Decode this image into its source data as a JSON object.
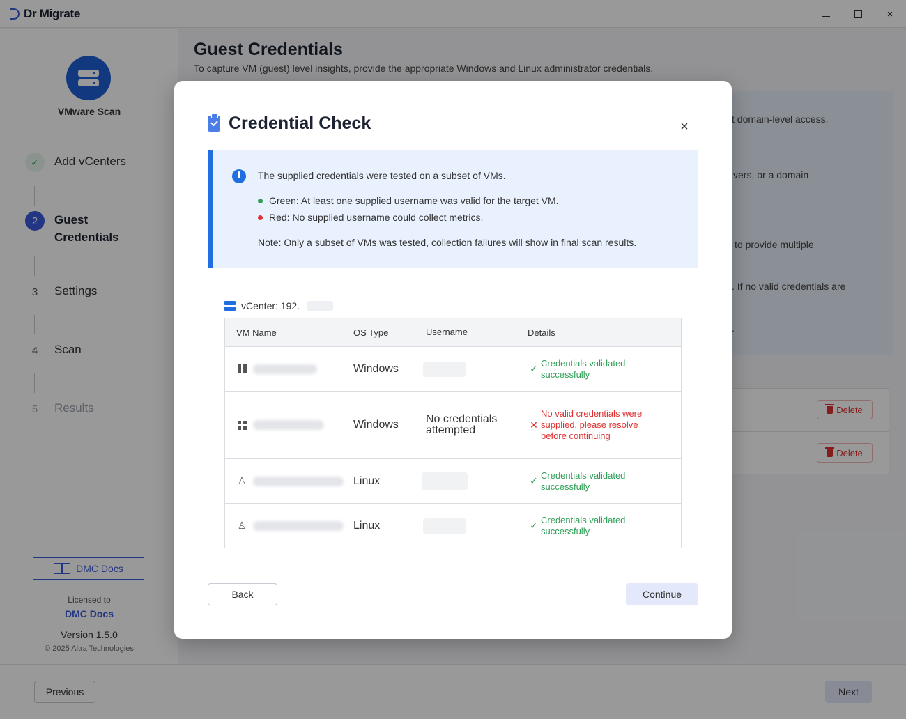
{
  "app": {
    "name": "Dr Migrate"
  },
  "window_controls": {
    "minimize": "–",
    "close": "×"
  },
  "sidebar": {
    "scan_title": "VMware Scan",
    "steps": [
      {
        "number": "✓",
        "label": "Add vCenters",
        "state": "done"
      },
      {
        "number": "2",
        "label": "Guest Credentials",
        "state": "active"
      },
      {
        "number": "3",
        "label": "Settings",
        "state": "pending"
      },
      {
        "number": "4",
        "label": "Scan",
        "state": "pending"
      },
      {
        "number": "5",
        "label": "Results",
        "state": "disabled"
      }
    ],
    "docs_button": "DMC Docs",
    "licensed_label": "Licensed to",
    "licensed_name": "DMC Docs",
    "version": "Version 1.5.0",
    "copyright": "© 2025 Altra Technologies"
  },
  "page": {
    "title": "Guest Credentials",
    "subtitle": "To capture VM (guest) level insights, provide the appropriate Windows and Linux administrator credentials.",
    "background_lines": [
      "t domain-level access.",
      "vers, or a domain",
      "to provide multiple",
      ". If no valid credentials are",
      "."
    ],
    "delete_label": "Delete"
  },
  "footer": {
    "previous": "Previous",
    "next": "Next"
  },
  "modal": {
    "title": "Credential Check",
    "close": "×",
    "alert": {
      "intro": "The supplied credentials were tested on a subset of VMs.",
      "green": "Green: At least one supplied username was valid for the target VM.",
      "red": "Red: No supplied username could collect metrics.",
      "note": "Note: Only a subset of VMs was tested, collection failures will show in final scan results."
    },
    "vcenter_label": "vCenter: 192.",
    "table": {
      "headers": [
        "VM Name",
        "OS Type",
        "Username",
        "Details"
      ],
      "rows": [
        {
          "os": "Windows",
          "username": "",
          "status": "ok",
          "details": "Credentials validated successfully"
        },
        {
          "os": "Windows",
          "username": "No credentials attempted",
          "status": "error",
          "details": "No valid credentials were supplied. please resolve before continuing"
        },
        {
          "os": "Linux",
          "username": "",
          "status": "ok",
          "details": "Credentials validated successfully"
        },
        {
          "os": "Linux",
          "username": "",
          "status": "ok",
          "details": "Credentials validated successfully"
        }
      ]
    },
    "back": "Back",
    "continue": "Continue"
  },
  "colors": {
    "accent": "#3b5bdb",
    "info_blue": "#1f6fe0",
    "success": "#2f9e57",
    "error": "#e03131"
  },
  "icons": {
    "logo": "dr-migrate-logo",
    "scan": "server-icon",
    "done_step": "check-icon",
    "docs": "book-icon",
    "modal": "clipboard-check-icon",
    "alert": "info-icon",
    "vcenter": "server-icon",
    "windows": "windows-icon",
    "linux": "linux-icon",
    "ok": "check-icon",
    "error": "x-icon",
    "delete": "trash-icon"
  }
}
